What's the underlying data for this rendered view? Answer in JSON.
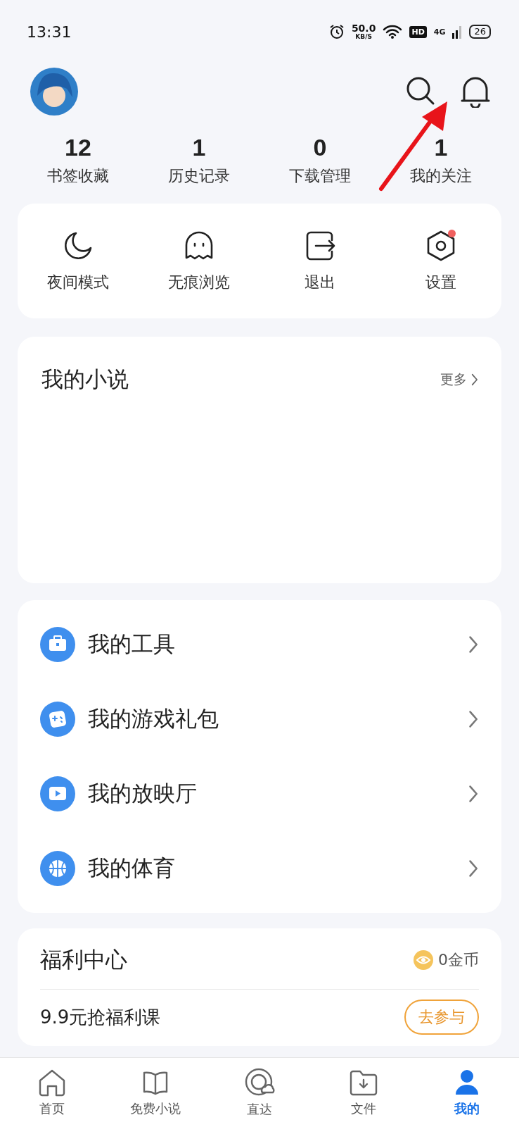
{
  "status_bar": {
    "time": "13:31",
    "speed": "50.0",
    "speed_unit": "KB/S",
    "hd": "HD",
    "network": "4G",
    "battery": "26"
  },
  "stats": [
    {
      "value": "12",
      "label": "书签收藏"
    },
    {
      "value": "1",
      "label": "历史记录"
    },
    {
      "value": "0",
      "label": "下载管理"
    },
    {
      "value": "1",
      "label": "我的关注"
    }
  ],
  "quick_actions": [
    {
      "kind": "moon",
      "label": "夜间模式",
      "badge": false
    },
    {
      "kind": "ghost",
      "label": "无痕浏览",
      "badge": false
    },
    {
      "kind": "exit",
      "label": "退出",
      "badge": false
    },
    {
      "kind": "settings",
      "label": "设置",
      "badge": true
    }
  ],
  "novels": {
    "title": "我的小说",
    "more": "更多"
  },
  "tools": [
    {
      "kind": "toolbox",
      "label": "我的工具"
    },
    {
      "kind": "game",
      "label": "我的游戏礼包"
    },
    {
      "kind": "play",
      "label": "我的放映厅"
    },
    {
      "kind": "ball",
      "label": "我的体育"
    }
  ],
  "welfare": {
    "title": "福利中心",
    "coins": "0金币",
    "task": "9.9元抢福利课",
    "action": "去参与"
  },
  "nav": [
    {
      "kind": "home",
      "label": "首页",
      "selected": false
    },
    {
      "kind": "book",
      "label": "免费小说",
      "selected": false
    },
    {
      "kind": "direct",
      "label": "直达",
      "selected": false
    },
    {
      "kind": "file",
      "label": "文件",
      "selected": false
    },
    {
      "kind": "me",
      "label": "我的",
      "selected": true
    }
  ]
}
